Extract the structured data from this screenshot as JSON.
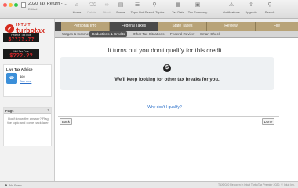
{
  "window": {
    "title": "2020 Tax Return - ...",
    "subtitle": "Edited"
  },
  "toolbar": {
    "items": [
      {
        "label": "Home",
        "icon": "home-icon"
      },
      {
        "label": "Delete",
        "icon": "delete-icon"
      },
      {
        "label": "Attach",
        "icon": "attach-icon"
      },
      {
        "label": "Forms",
        "icon": "forms-icon"
      },
      {
        "label": "Topic List",
        "icon": "topic-list-icon"
      },
      {
        "label": "Search Topics",
        "icon": "search-topics-icon"
      },
      {
        "label": "Tax Data",
        "icon": "tax-data-icon"
      },
      {
        "label": "Tax Summary",
        "icon": "tax-summary-icon"
      },
      {
        "label": "Notifications",
        "icon": "bell-icon"
      },
      {
        "label": "Upgrade",
        "icon": "upgrade-icon"
      },
      {
        "label": "Search",
        "icon": "search-icon"
      }
    ]
  },
  "sidebar": {
    "logo": {
      "brand": "INTUIT",
      "product": "turbotax",
      "edition": "Premier"
    },
    "federal_refund": {
      "label": "Federal Tax Due",
      "value": "$????.??"
    },
    "mn_refund": {
      "label": "MN Tax Due",
      "value": "$???.??"
    },
    "live_advice": {
      "title": "Live Tax Advice",
      "price": "$60",
      "buy_label": "Buy now"
    },
    "flags": {
      "label": "Flags",
      "message": "Don't know the answer? Flag the topic and come back later."
    }
  },
  "tabs": {
    "items": [
      "Personal Info",
      "Federal Taxes",
      "State Taxes",
      "Review",
      "File"
    ],
    "active": "Federal Taxes"
  },
  "subtabs": {
    "items": [
      "Wages & Income",
      "Deductions & Credits",
      "Other Tax Situations",
      "Federal Review",
      "Smart Check"
    ],
    "active": "Deductions & Credits"
  },
  "main": {
    "headline": "It turns out you don't qualify for this credit",
    "card_message": "We'll keep looking for other tax breaks for you.",
    "why_link": "Why don't I qualify?",
    "back_label": "Back",
    "done_label": "Done"
  },
  "statusbar": {
    "left": "No Form",
    "right": "TAX2020 Re-open in Intuit TurboTax Premier 2020. © Intuit Inc."
  },
  "colors": {
    "brand_red": "#d52b1e",
    "tab_gold": "#b8a378",
    "link_blue": "#2a6fc9"
  }
}
